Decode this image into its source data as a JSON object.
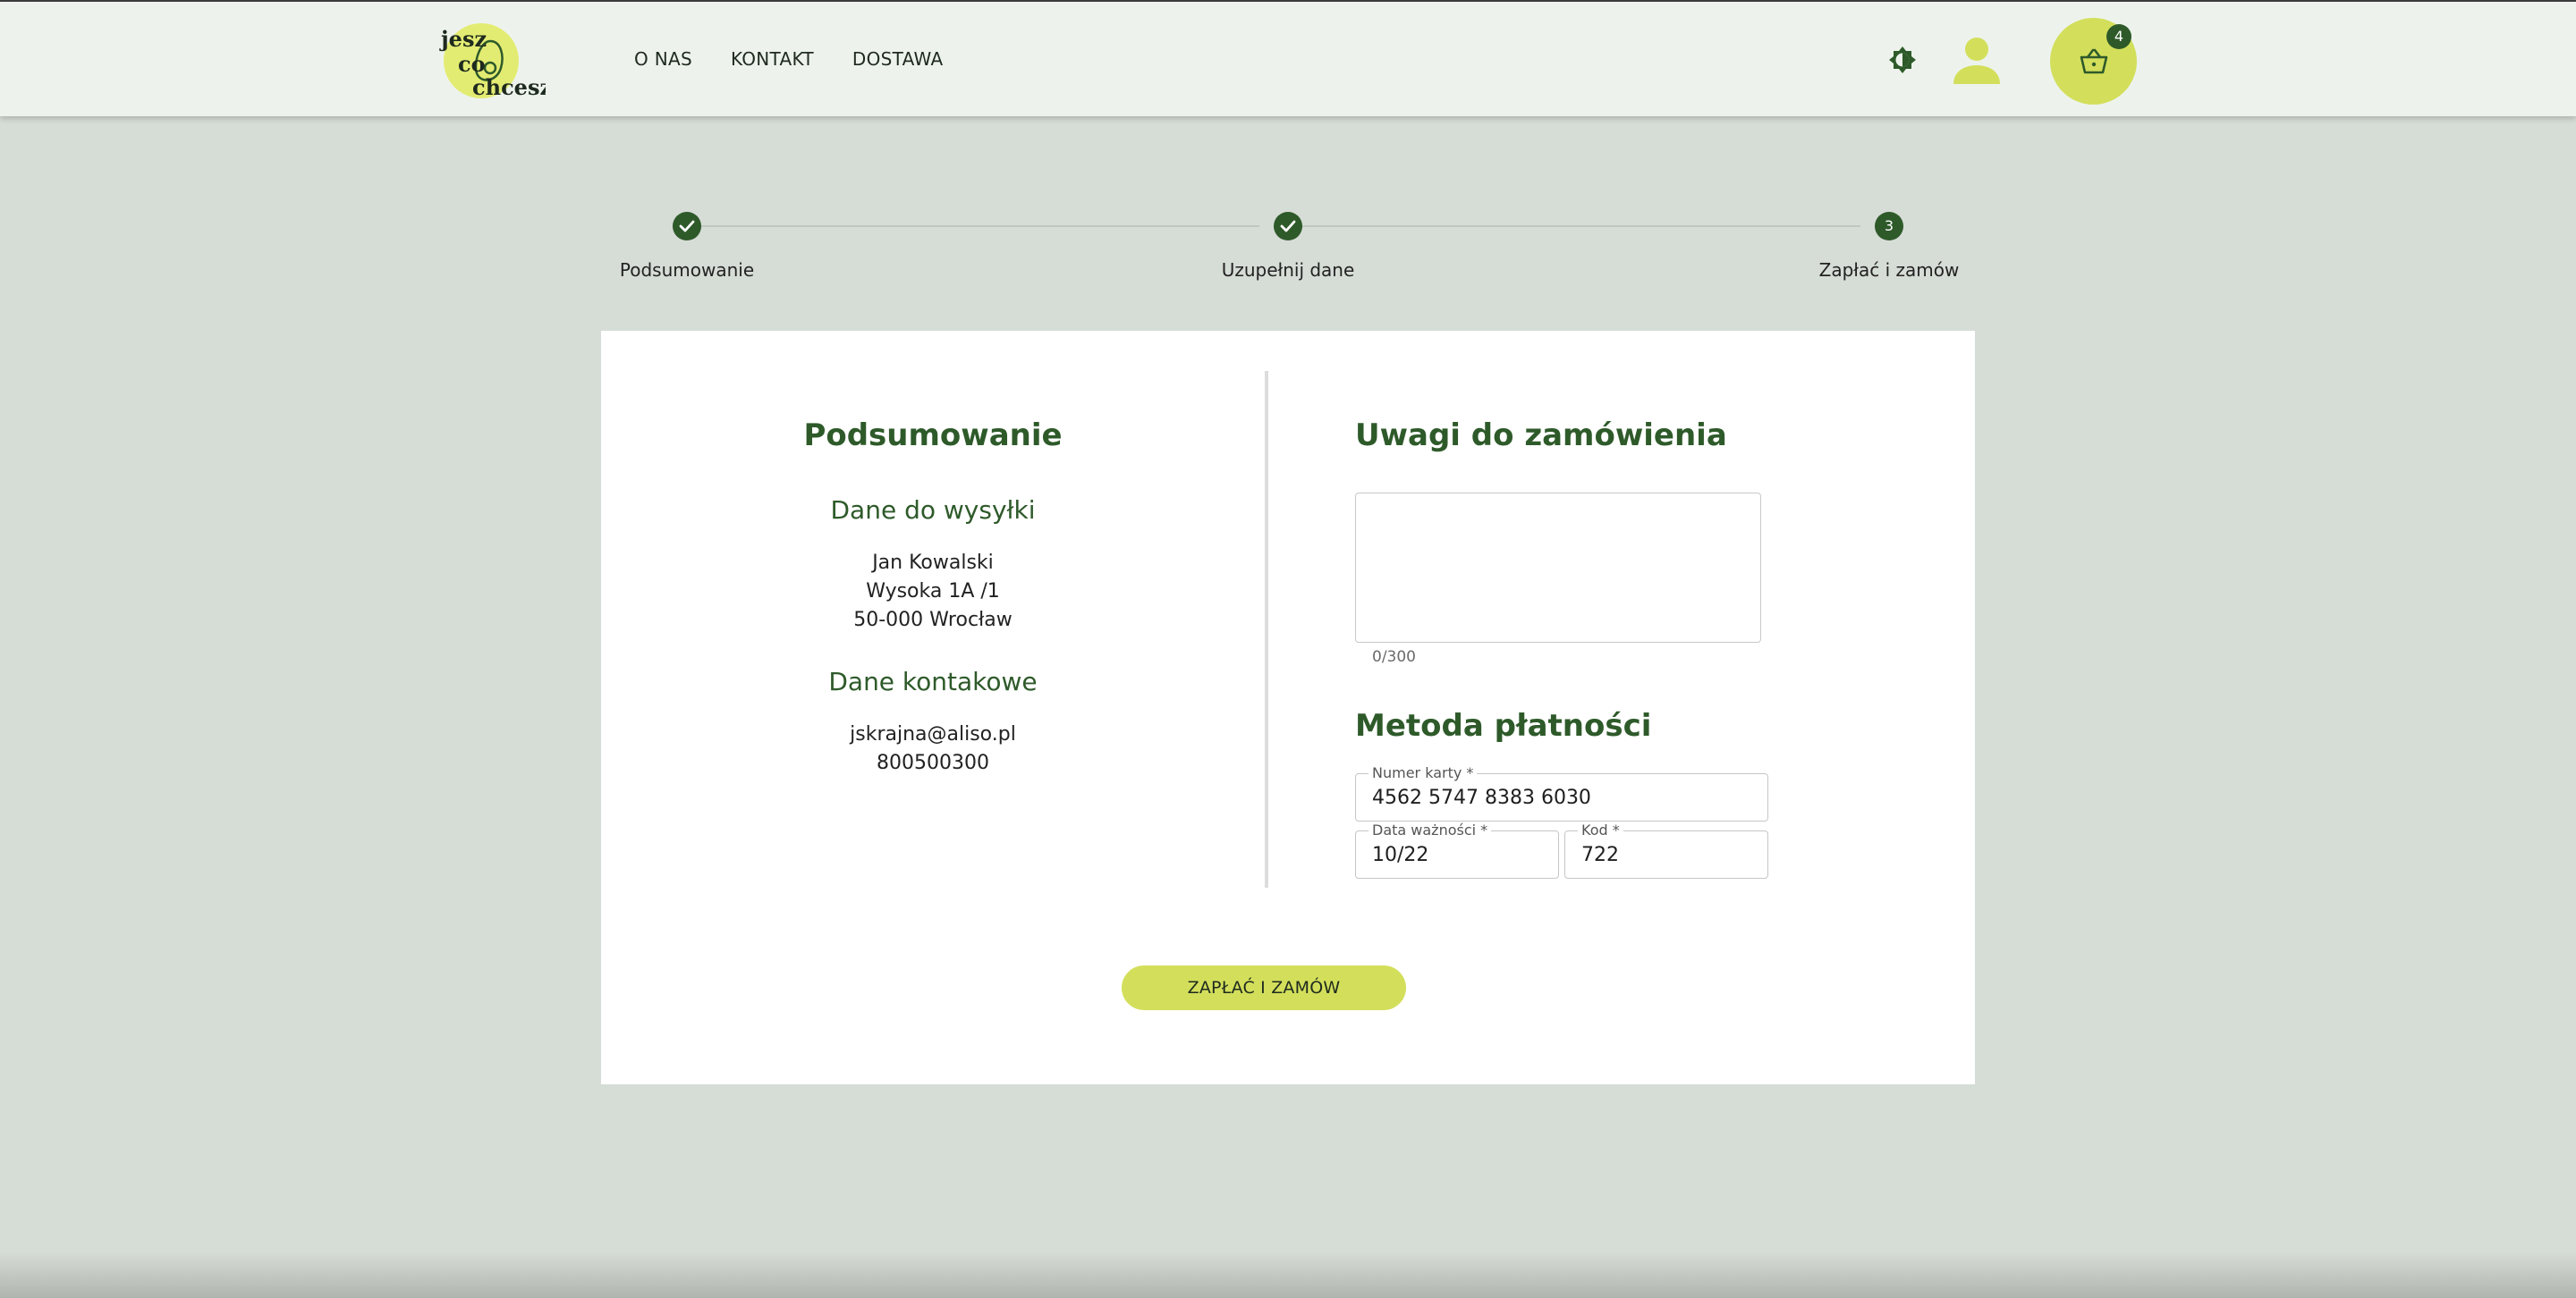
{
  "header": {
    "logo": {
      "line1": "jesz",
      "line2": "co",
      "line3": "chcesz"
    },
    "nav": [
      "O NAS",
      "KONTAKT",
      "DOSTAWA"
    ],
    "cart_count": "4",
    "icons": {
      "theme": "theme-toggle-icon",
      "user": "user-icon",
      "cart": "basket-icon"
    }
  },
  "stepper": {
    "steps": [
      {
        "label": "Podsumowanie",
        "state": "done"
      },
      {
        "label": "Uzupełnij dane",
        "state": "done"
      },
      {
        "label": "Zapłać i zamów",
        "state": "active",
        "number": "3"
      }
    ]
  },
  "summary": {
    "title": "Podsumowanie",
    "shipping_title": "Dane do wysyłki",
    "shipping_lines": [
      "Jan Kowalski",
      "Wysoka 1A /1",
      "50-000 Wrocław"
    ],
    "contact_title": "Dane kontakowe",
    "contact_lines": [
      "jskrajna@aliso.pl",
      "800500300"
    ]
  },
  "notes": {
    "title": "Uwagi do zamówienia",
    "value": "",
    "counter": "0/300"
  },
  "payment": {
    "title": "Metoda płatności",
    "card_number": {
      "label": "Numer karty *",
      "value": "4562 5747 8383 6030"
    },
    "expiry": {
      "label": "Data ważności *",
      "value": "10/22"
    },
    "code": {
      "label": "Kod *",
      "value": "722"
    }
  },
  "submit_label": "ZAPŁAĆ I ZAMÓW",
  "colors": {
    "accent": "#d3df5b",
    "dark_green": "#2e5a2a",
    "background": "#d6dcd6",
    "header_bg": "#edf3ec"
  }
}
